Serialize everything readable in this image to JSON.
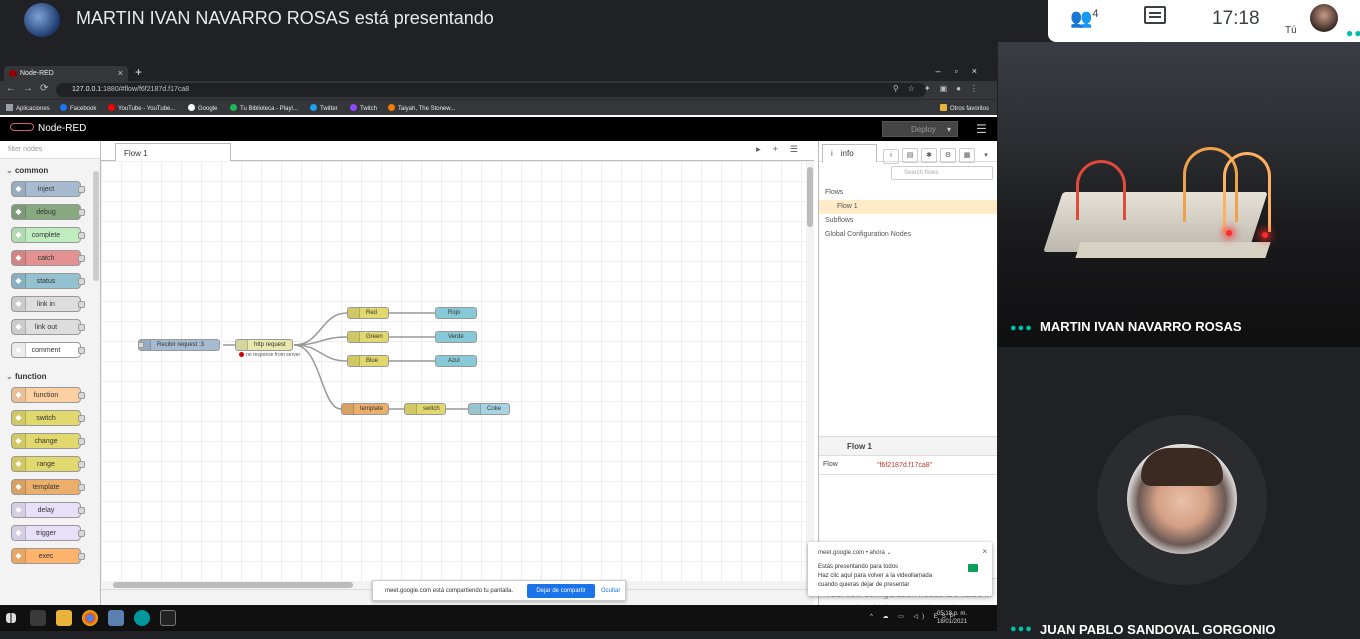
{
  "meet": {
    "presenting_title": "MARTIN IVAN NAVARRO ROSAS está presentando",
    "participants_count": "4",
    "time": "17:18",
    "self_label": "Tú",
    "tiles": [
      {
        "name": "MARTIN IVAN NAVARRO ROSAS"
      },
      {
        "name": "JUAN PABLO SANDOVAL GORGONIO"
      }
    ],
    "accent_color": "#00bfa5"
  },
  "browser": {
    "tab_title": "Node-RED",
    "url_host": "127.0.0.1",
    "url_rest": ":1880/#flow/f6f2187d.f17ca8",
    "bookmarks": [
      {
        "label": "Aplicaciones",
        "color": "#9aa0a6"
      },
      {
        "label": "Facebook",
        "color": "#1877f2"
      },
      {
        "label": "YouTube - YouTube...",
        "color": "#ff0000"
      },
      {
        "label": "Google",
        "color": "#ffffff"
      },
      {
        "label": "Tu Biblioteca - Playl...",
        "color": "#1db954"
      },
      {
        "label": "Twitter",
        "color": "#1da1f2"
      },
      {
        "label": "Twitch",
        "color": "#9146ff"
      },
      {
        "label": "Taiyah, The Stonew...",
        "color": "#f57c00"
      }
    ],
    "other_bookmarks": "Otros favoritos"
  },
  "nodered": {
    "logo": "Node-RED",
    "deploy_label": "Deploy",
    "filter_placeholder": "filter nodes",
    "categories": {
      "common": "common",
      "function": "function"
    },
    "common_nodes": [
      {
        "label": "inject",
        "color": "#a6bbcf"
      },
      {
        "label": "debug",
        "color": "#87a980"
      },
      {
        "label": "complete",
        "color": "#c0edc0"
      },
      {
        "label": "catch",
        "color": "#e49191"
      },
      {
        "label": "status",
        "color": "#94c1d0"
      },
      {
        "label": "link in",
        "color": "#dddddd"
      },
      {
        "label": "link out",
        "color": "#dddddd"
      },
      {
        "label": "comment",
        "color": "#ffffff"
      }
    ],
    "function_nodes": [
      {
        "label": "function",
        "color": "#fdd0a2"
      },
      {
        "label": "switch",
        "color": "#e2d96e"
      },
      {
        "label": "change",
        "color": "#e2d96e"
      },
      {
        "label": "range",
        "color": "#e2d96e"
      },
      {
        "label": "template",
        "color": "#ebae6b"
      },
      {
        "label": "delay",
        "color": "#e6e0f8"
      },
      {
        "label": "trigger",
        "color": "#e6e0f8"
      },
      {
        "label": "exec",
        "color": "#fdb36b"
      }
    ],
    "flow_tab": "Flow 1",
    "flow_nodes": {
      "http_in": "Recibir request :3",
      "http_request": "http request",
      "http_request_status": "no response from server",
      "red": "Red",
      "green": "Green",
      "blue": "Blue",
      "rojo": "Rojo",
      "verde": "Verde",
      "azul": "Azul",
      "template": "template",
      "switch": "switch",
      "coke": "Coke"
    },
    "sidebar": {
      "tab": "info",
      "search_placeholder": "Search flows",
      "tree": {
        "flows": "Flows",
        "flow1": "Flow 1",
        "subflows": "Subflows",
        "global_config": "Global Configuration Nodes"
      },
      "props_title": "Flow 1",
      "prop_key": "Flow",
      "prop_value": "\"f6f2187d.f17ca8\"",
      "help_text": "Your flow configuration nodes are listed in the sidebar panel. It can be"
    }
  },
  "share_bar": {
    "message": "meet.google.com está compartiendo tu pantalla.",
    "stop": "Dejar de compartir",
    "hide": "Ocultar"
  },
  "notification": {
    "header": "meet.google.com • ahora ⌄",
    "line1": "Estás presentando para todos",
    "line2": "Haz clic aquí para volver a la videollamada",
    "line3": "cuando quieras dejar de presentar"
  },
  "taskbar": {
    "lang": "ESP",
    "time": "05:18 p. m.",
    "date": "18/01/2021"
  }
}
